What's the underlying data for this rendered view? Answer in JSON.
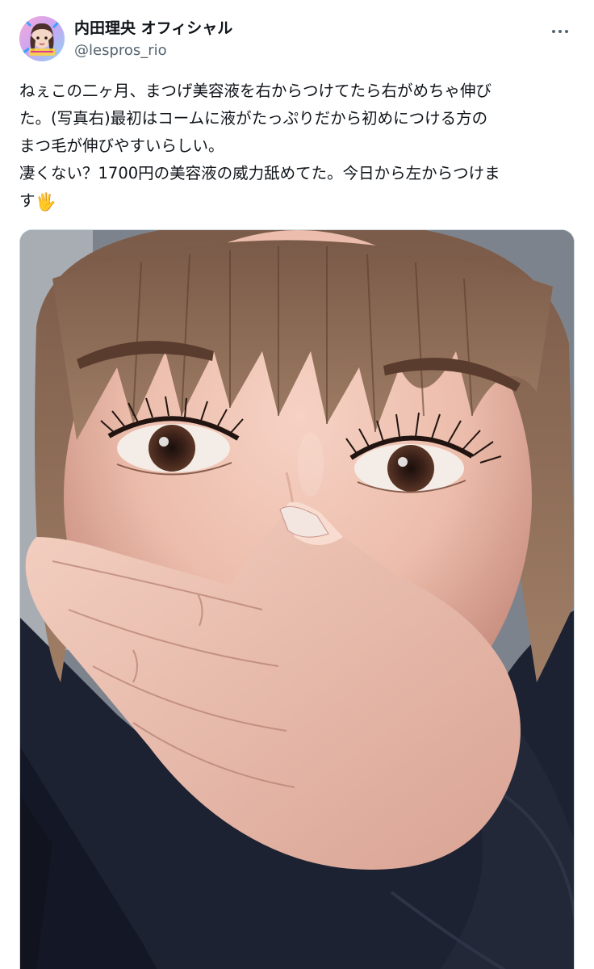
{
  "author": {
    "display_name": "内田理央 オフィシャル",
    "handle": "@lespros_rio",
    "avatar_icon": "profile-avatar-image"
  },
  "menu": {
    "more_icon": "more-options-icon"
  },
  "tweet": {
    "lines": [
      "ねぇこの二ヶ月、まつげ美容液を右からつけてたら右がめちゃ伸び",
      "た。(写真右)最初はコームに液がたっぷりだから初めにつける方の",
      "まつ毛が伸びやすいらしい。",
      "凄くない？1700円の美容液の威力舐めてた。今日から左からつけま",
      "す"
    ],
    "emoji": "🖐"
  },
  "media": {
    "type": "photo",
    "icon": "photo-image"
  },
  "colors": {
    "text": "#0f1419",
    "secondary": "#536471",
    "border": "#cfd9de"
  }
}
